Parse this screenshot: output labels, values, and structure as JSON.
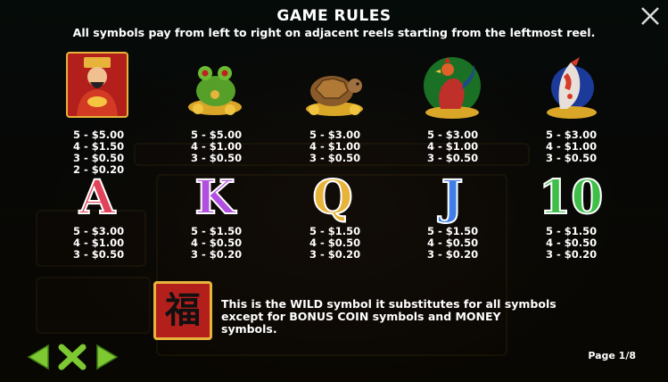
{
  "header": {
    "title": "GAME RULES",
    "subtitle": "All symbols pay from left to right on adjacent reels starting from the leftmost reel."
  },
  "symbols_row1": [
    {
      "name": "emperor",
      "payouts": [
        "5 - $5.00",
        "4 - $1.50",
        "3 - $0.50",
        "2 - $0.20"
      ]
    },
    {
      "name": "frog",
      "payouts": [
        "5 - $5.00",
        "4 - $1.00",
        "3 - $0.50"
      ]
    },
    {
      "name": "turtle",
      "payouts": [
        "5 - $3.00",
        "4 - $1.00",
        "3 - $0.50"
      ]
    },
    {
      "name": "rooster",
      "payouts": [
        "5 - $3.00",
        "4 - $1.00",
        "3 - $0.50"
      ]
    },
    {
      "name": "koi",
      "payouts": [
        "5 - $3.00",
        "4 - $1.00",
        "3 - $0.50"
      ]
    }
  ],
  "symbols_row2": [
    {
      "name": "A",
      "glyph": "A",
      "color": "#e0435a",
      "payouts": [
        "5 - $3.00",
        "4 - $1.00",
        "3 - $0.50"
      ]
    },
    {
      "name": "K",
      "glyph": "K",
      "color": "#b04fe0",
      "payouts": [
        "5 - $1.50",
        "4 - $0.50",
        "3 - $0.20"
      ]
    },
    {
      "name": "Q",
      "glyph": "Q",
      "color": "#e8b33a",
      "payouts": [
        "5 - $1.50",
        "4 - $0.50",
        "3 - $0.20"
      ]
    },
    {
      "name": "J",
      "glyph": "J",
      "color": "#3f7ee8",
      "payouts": [
        "5 - $1.50",
        "4 - $0.50",
        "3 - $0.20"
      ]
    },
    {
      "name": "10",
      "glyph": "10",
      "color": "#3fbf4a",
      "payouts": [
        "5 - $1.50",
        "4 - $0.50",
        "3 - $0.20"
      ]
    }
  ],
  "wild": {
    "glyph": "福",
    "line1": "This is the WILD symbol it substitutes for all symbols",
    "line2": "except for BONUS COIN symbols and MONEY symbols."
  },
  "footer": {
    "page": "Page 1/8"
  },
  "colors": {
    "nav_green": "#7ec832",
    "close": "#dddddd"
  }
}
